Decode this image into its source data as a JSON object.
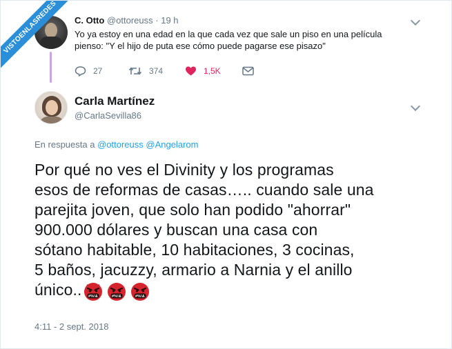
{
  "watermark": {
    "text": "VISTOENLASREDES"
  },
  "tweet1": {
    "name": "C. Otto",
    "handle": "@ottoreuss",
    "separator": "·",
    "time": "19 h",
    "text_line1": "Yo ya estoy en una edad en la que cada vez que sale un piso en una película",
    "text_line2": "pienso: \"Y el hijo de puta ese cómo puede pagarse ese pisazo\"",
    "actions": {
      "replies": "27",
      "retweets": "374",
      "likes": "1,5K"
    },
    "icons": [
      "reply-icon",
      "retweet-icon",
      "heart-icon",
      "mail-icon",
      "chevron-down-icon"
    ]
  },
  "tweet2": {
    "name": "Carla Martínez",
    "handle": "@CarlaSevilla86",
    "reply_prefix": "En respuesta a",
    "reply_mentions": [
      "@ottoreuss",
      "@Angelarom"
    ],
    "text_lines": [
      "Por qué no ves el Divinity y los programas",
      "esos de reformas de casas….. cuando sale una",
      "parejita joven, que solo han podido \"ahorrar\"",
      "900.000 dólares y buscan una casa con",
      "sótano habitable, 10 habitaciones, 3 cocinas,",
      "5 baños, jacuzzy, armario a Narnia y el anillo",
      "único.."
    ],
    "emoji": [
      "face-with-symbols-on-mouth",
      "face-with-symbols-on-mouth",
      "face-with-symbols-on-mouth"
    ],
    "emoji_symbol_text": "#%!&",
    "timestamp": "4:11 - 2 sept. 2018"
  },
  "colors": {
    "accent": "#1da1f2",
    "like": "#e0245e",
    "muted": "#657786",
    "thread_line": "#c9a5e6",
    "ribbon": "#2a8fd8",
    "emoji_face": "#d6242f"
  }
}
